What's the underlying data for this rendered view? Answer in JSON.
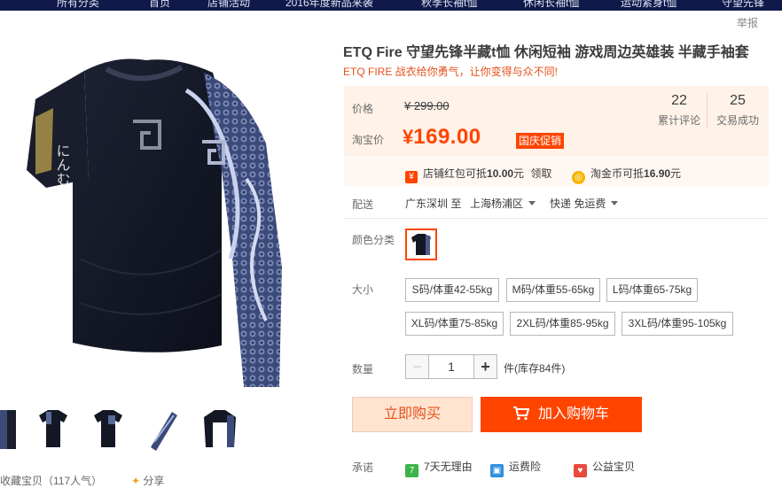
{
  "topnav": {
    "items": [
      "所有分类",
      "首页",
      "店铺活动",
      "2016年度新品来袭",
      "秋季长袖t恤",
      "休闲长袖t恤",
      "运动紧身t恤",
      "守望先锋"
    ]
  },
  "report_label": "举报",
  "product": {
    "title": "ETQ Fire 守望先锋半藏t恤 休闲短袖 游戏周边英雄装 半藏手袖套",
    "subtitle": "ETQ FIRE 战衣给你勇气，让你变得与众不同!"
  },
  "price": {
    "label": "价格",
    "currency": "¥",
    "original": "299.00",
    "taobao_label": "淘宝价",
    "current": "169.00",
    "promo_tag": "国庆促销",
    "accent_color": "#ff4400"
  },
  "stats": {
    "reviews_count": "22",
    "reviews_label": "累计评论",
    "sales_count": "25",
    "sales_label": "交易成功"
  },
  "coupons": {
    "shop_redpack_prefix": "店铺红包可抵",
    "shop_redpack_amount": "10.00",
    "shop_redpack_suffix": "元",
    "shop_redpack_action": "领取",
    "coin_prefix": "淘金币可抵",
    "coin_amount": "16.90",
    "coin_suffix": "元"
  },
  "shipping": {
    "label": "配送",
    "from": "广东深圳 至",
    "to": "上海杨浦区",
    "method": "快递 免运费"
  },
  "color": {
    "label": "颜色分类"
  },
  "size": {
    "label": "大小",
    "options": [
      "S码/体重42-55kg",
      "M码/体重55-65kg",
      "L码/体重65-75kg",
      "XL码/体重75-85kg",
      "2XL码/体重85-95kg",
      "3XL码/体重95-105kg"
    ]
  },
  "quantity": {
    "label": "数量",
    "minus": "−",
    "value": "1",
    "plus": "+",
    "stock_text": "件(库存84件)"
  },
  "actions": {
    "buy_now": "立即购买",
    "add_to_cart": "加入购物车"
  },
  "promise": {
    "label": "承诺",
    "items": [
      "7天无理由",
      "运费险",
      "公益宝贝"
    ]
  },
  "bottom": {
    "favorite": "收藏宝贝（117人气）",
    "share": "分享"
  }
}
